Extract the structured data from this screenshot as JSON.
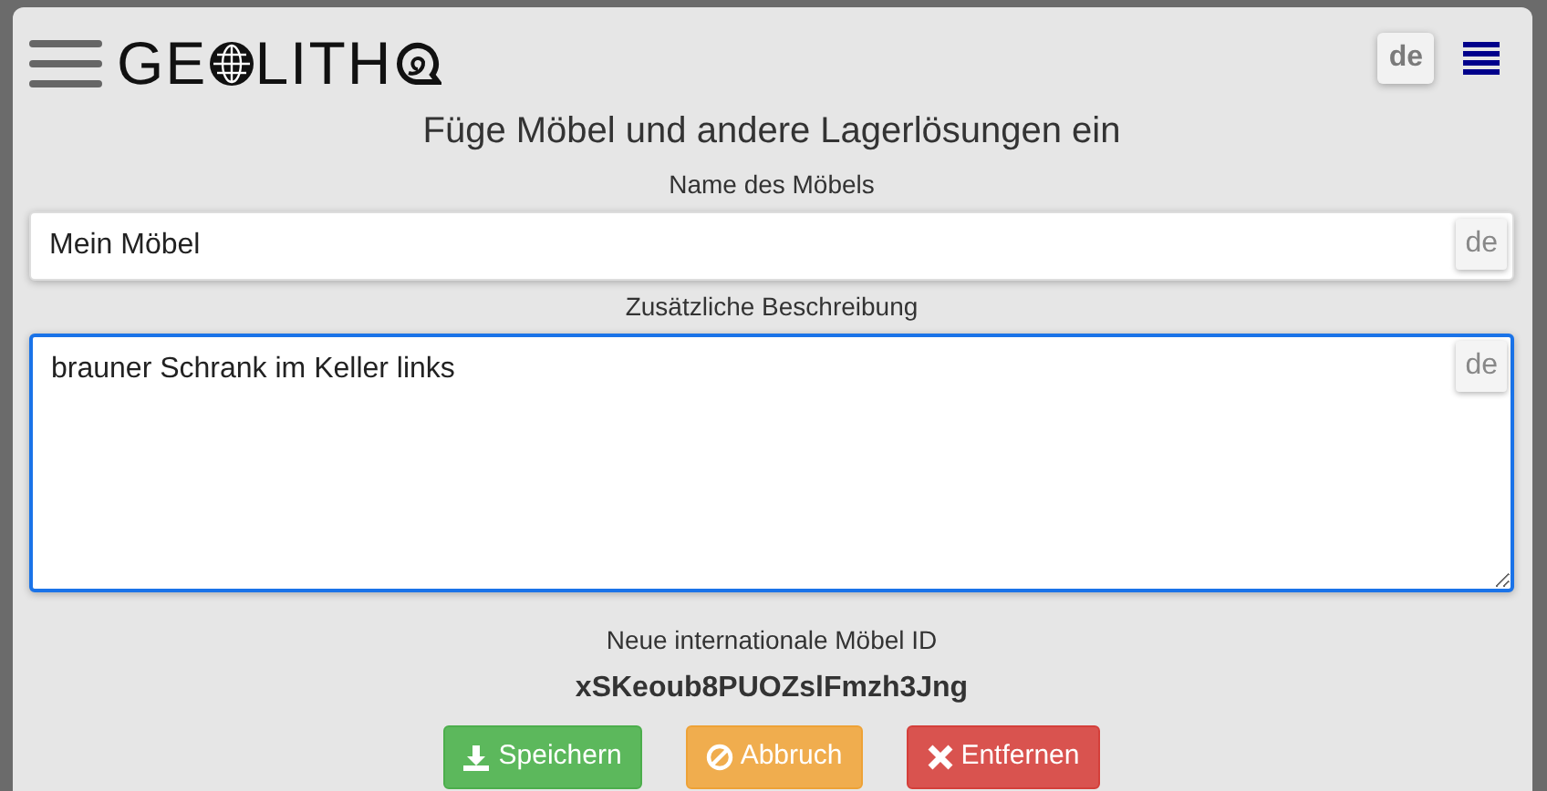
{
  "logo": {
    "parts": [
      "GE",
      "LITH"
    ]
  },
  "header": {
    "language": "de"
  },
  "title": "Füge Möbel und andere Lagerlösungen ein",
  "fields": [
    {
      "kind": "input",
      "label": "Name des Möbels",
      "value": "Mein Möbel",
      "language": "de",
      "focused": false
    },
    {
      "kind": "textarea",
      "label": "Zusätzliche Beschreibung",
      "value": "brauner Schrank im Keller links",
      "language": "de",
      "focused": true
    }
  ],
  "id_label": "Neue internationale Möbel ID",
  "id_value": "xSKeoub8PUOZslFmzh3Jng",
  "buttons": [
    {
      "kind": "save",
      "label": "Speichern"
    },
    {
      "kind": "cancel",
      "label": "Abbruch"
    },
    {
      "kind": "delete",
      "label": "Entfernen"
    }
  ]
}
